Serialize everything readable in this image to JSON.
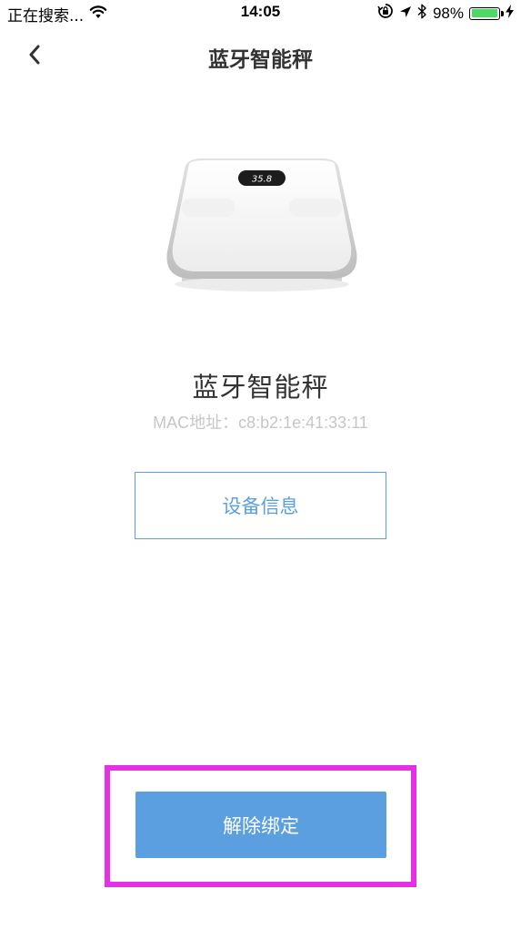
{
  "status_bar": {
    "carrier": "正在搜索...",
    "time": "14:05",
    "battery_percent": "98%",
    "battery_level": 0.98,
    "icons": [
      "wifi-icon",
      "rotation-lock-icon",
      "location-icon",
      "bluetooth-icon",
      "battery-icon",
      "charging-icon"
    ]
  },
  "nav": {
    "title": "蓝牙智能秤",
    "back_icon": "chevron-left-icon"
  },
  "device": {
    "image_icon": "smart-scale-icon",
    "display_reading": "35.8",
    "name": "蓝牙智能秤",
    "mac_address": "MAC地址：c8:b2:1e:41:33:11",
    "info_button_label": "设备信息"
  },
  "actions": {
    "unbind_label": "解除绑定"
  },
  "colors": {
    "accent": "#5c9fe1",
    "highlight": "#e630e6",
    "title_text": "#333333",
    "muted_text": "#c6c6c6",
    "battery_green": "#4cd964"
  }
}
